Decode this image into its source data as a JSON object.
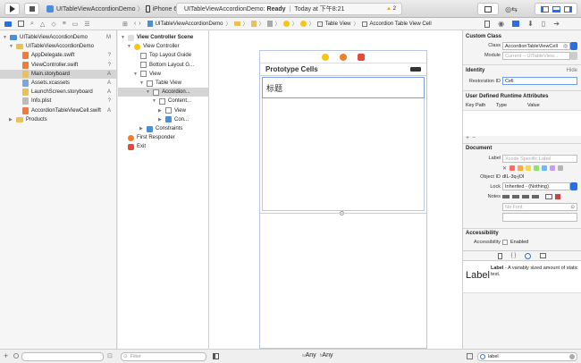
{
  "toolbar": {
    "scheme_project": "UITableViewAccordionDemo",
    "scheme_separator": "〉",
    "scheme_device": "iPhone 6s Plus",
    "status_text": "UITableViewAccordionDemo: ",
    "status_state": "Ready",
    "status_sep": "|",
    "status_time": "Today at 下午8:21",
    "warning_count": "2"
  },
  "jumpbar": {
    "crumbs": [
      "UITableViewAccordionDemo",
      "〉",
      "〉",
      "〉",
      "〉",
      "〉",
      "〉",
      "Table View",
      "〉",
      "Accordion Table View Cell"
    ]
  },
  "navigator": {
    "items": [
      {
        "label": "UITableViewAccordionDemo",
        "badge": "M",
        "indent": 0,
        "kind": "project",
        "tri": "▼"
      },
      {
        "label": "UITableViewAccordionDemo",
        "badge": "",
        "indent": 1,
        "kind": "folder",
        "tri": "▼"
      },
      {
        "label": "AppDelegate.swift",
        "badge": "?",
        "indent": 2,
        "kind": "swift",
        "tri": ""
      },
      {
        "label": "ViewController.swift",
        "badge": "?",
        "indent": 2,
        "kind": "swift",
        "tri": ""
      },
      {
        "label": "Main.storyboard",
        "badge": "A",
        "indent": 2,
        "kind": "storyboard",
        "tri": "",
        "selected": true
      },
      {
        "label": "Assets.xcassets",
        "badge": "A",
        "indent": 2,
        "kind": "assets",
        "tri": ""
      },
      {
        "label": "LaunchScreen.storyboard",
        "badge": "A",
        "indent": 2,
        "kind": "storyboard",
        "tri": ""
      },
      {
        "label": "Info.plist",
        "badge": "?",
        "indent": 2,
        "kind": "plist",
        "tri": ""
      },
      {
        "label": "AccordionTableViewCell.swift",
        "badge": "A",
        "indent": 2,
        "kind": "swift",
        "tri": ""
      },
      {
        "label": "Products",
        "badge": "",
        "indent": 1,
        "kind": "folder",
        "tri": "▶"
      }
    ],
    "filter_placeholder": ""
  },
  "outline": {
    "items": [
      {
        "label": "View Controller Scene",
        "indent": 0,
        "tri": "▼",
        "kind": "scene",
        "bold": true
      },
      {
        "label": "View Controller",
        "indent": 1,
        "tri": "▼",
        "kind": "vc"
      },
      {
        "label": "Top Layout Guide",
        "indent": 2,
        "tri": "",
        "kind": "guide"
      },
      {
        "label": "Bottom Layout G...",
        "indent": 2,
        "tri": "",
        "kind": "guide"
      },
      {
        "label": "View",
        "indent": 2,
        "tri": "▼",
        "kind": "view"
      },
      {
        "label": "Table View",
        "indent": 3,
        "tri": "▼",
        "kind": "view"
      },
      {
        "label": "Accordion...",
        "indent": 4,
        "tri": "▼",
        "kind": "view",
        "selected": true
      },
      {
        "label": "Content...",
        "indent": 5,
        "tri": "▼",
        "kind": "view"
      },
      {
        "label": "View",
        "indent": 6,
        "tri": "▶",
        "kind": "view"
      },
      {
        "label": "Con...",
        "indent": 6,
        "tri": "▶",
        "kind": "constraint"
      },
      {
        "label": "Constraints",
        "indent": 3,
        "tri": "▶",
        "kind": "constraint"
      },
      {
        "label": "First Responder",
        "indent": 0,
        "tri": "",
        "kind": "responder"
      },
      {
        "label": "Exit",
        "indent": 0,
        "tri": "",
        "kind": "exit"
      }
    ],
    "filter_placeholder": "Filter"
  },
  "canvas": {
    "prototype_header": "Prototype Cells",
    "cell_label": "标题",
    "size_w": "Any",
    "size_h": "Any",
    "size_prefix_w": "w",
    "size_prefix_h": "h"
  },
  "inspector": {
    "custom_class": {
      "title": "Custom Class",
      "class_label": "Class",
      "class_value": "AccordionTableViewCell",
      "module_label": "Module",
      "module_placeholder": "Current – UITableView..."
    },
    "identity": {
      "title": "Identity",
      "hide": "Hide",
      "restoration_label": "Restoration ID",
      "restoration_value": "Cell"
    },
    "runtime": {
      "title": "User Defined Runtime Attributes",
      "cols": [
        "Key Path",
        "Type",
        "Value"
      ]
    },
    "document": {
      "title": "Document",
      "label_label": "Label",
      "label_placeholder": "Xcode Specific Label",
      "object_id_label": "Object ID",
      "object_id_value": "dIL-3q-jOI",
      "lock_label": "Lock",
      "lock_value": "Inherited - (Nothing)",
      "notes_label": "Notes",
      "font_placeholder": "No Font"
    },
    "accessibility": {
      "title": "Accessibility",
      "acc_label": "Accessibility",
      "enabled": "Enabled"
    },
    "library": {
      "item_name": "Label",
      "item_title": "Label",
      "item_desc": " - A variably sized amount of static text.",
      "search_value": "label"
    },
    "label_colors": [
      "#ff6b5f",
      "#ffa83b",
      "#f7d74c",
      "#8ee36a",
      "#68b9ff",
      "#c99cf0",
      "#b5b5b5"
    ]
  }
}
